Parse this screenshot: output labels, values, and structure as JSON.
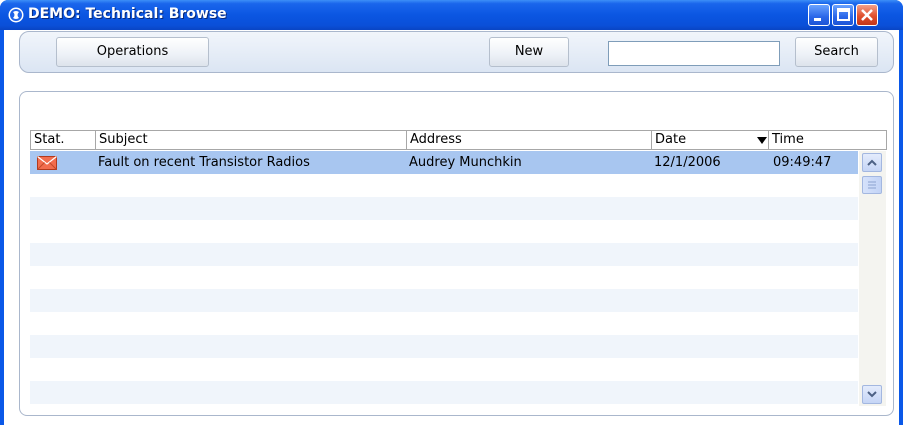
{
  "window": {
    "title": "DEMO: Technical: Browse",
    "accent_color": "#0a58e8"
  },
  "toolbar": {
    "operations_label": "Operations",
    "new_label": "New",
    "search_value": "",
    "search_label": "Search"
  },
  "table": {
    "columns": [
      "Stat.",
      "Subject",
      "Address",
      "Date",
      "Time"
    ],
    "sort_column": "Date",
    "rows": [
      {
        "status_icon": "envelope-icon",
        "subject": "Fault on recent Transistor Radios",
        "address": "Audrey Munchkin",
        "date": "12/1/2006",
        "time": "09:49:47",
        "selected": true
      }
    ],
    "selected_row_color": "#a8c6f0",
    "alt_row_color": "#f0f5fb"
  }
}
